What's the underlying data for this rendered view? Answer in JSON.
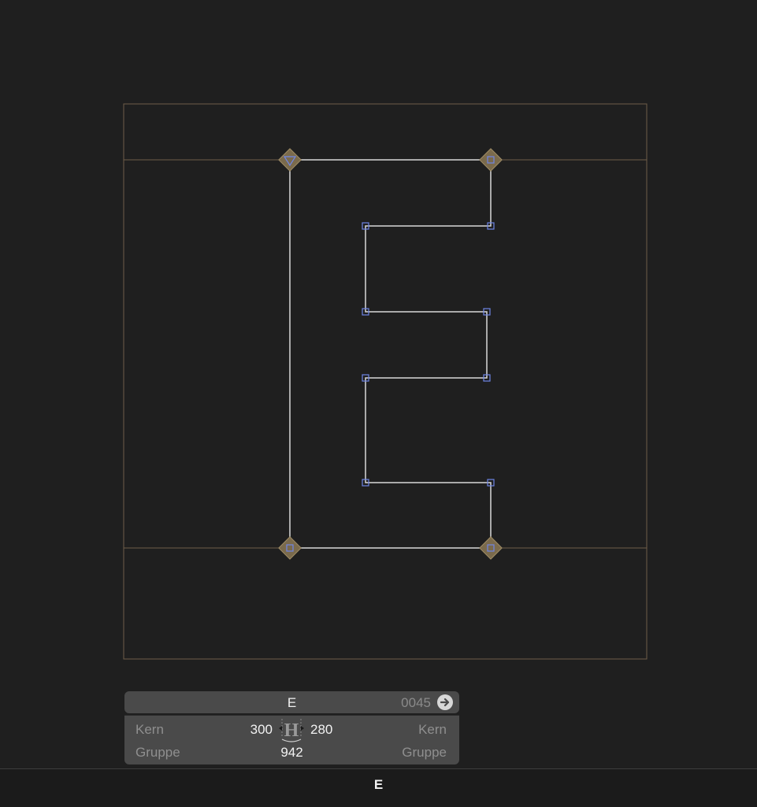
{
  "glyph": {
    "name": "E",
    "unicode": "0045"
  },
  "metrics": {
    "kern_left_label": "Kern",
    "kern_right_label": "Kern",
    "group_left_label": "Gruppe",
    "group_right_label": "Gruppe",
    "left_sidebearing": "300",
    "right_sidebearing": "280",
    "width": "942",
    "sidebearing_glyph": "H"
  },
  "status_bar": {
    "glyph": "E"
  },
  "colors": {
    "background": "#1f1f1f",
    "metric_lines": "#6f5e49",
    "outline": "#d8d8d8",
    "node_corner": "#6f86e6",
    "node_extreme": "#8a7a5a",
    "panel": "#4a4a4a"
  },
  "icons": {
    "goto": "arrow-right-circle-icon"
  }
}
